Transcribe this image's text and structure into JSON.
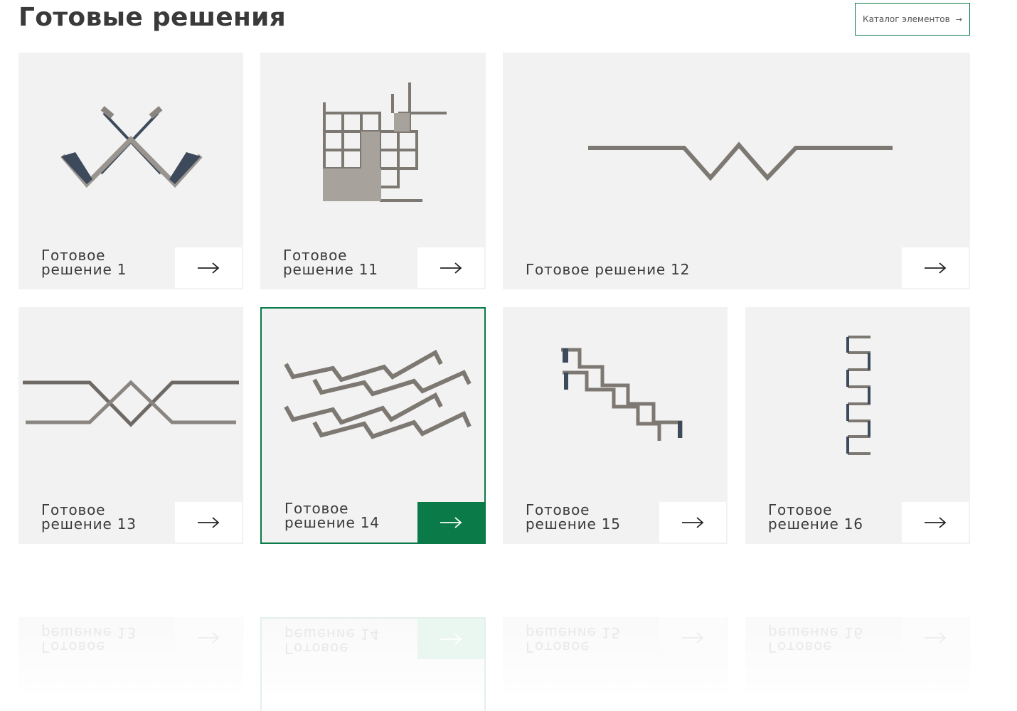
{
  "header": {
    "title": "Готовые решения",
    "catalog_button": "Каталог элементов"
  },
  "cards": [
    {
      "label": "Готовое решение 1"
    },
    {
      "label": "Готовое решение 11"
    },
    {
      "label": "Готовое решение 12"
    },
    {
      "label": "Готовое решение 13"
    },
    {
      "label": "Готовое решение 14",
      "active": true
    },
    {
      "label": "Готовое решение 15"
    },
    {
      "label": "Готовое решение 16"
    }
  ],
  "reflection": [
    {
      "label": "Готовое решение 13"
    },
    {
      "label": "Готовое решение 14"
    },
    {
      "label": "Готовое решение 15"
    },
    {
      "label": "Готовое решение 16"
    }
  ],
  "colors": {
    "accent": "#0a7a48",
    "card_bg": "#f2f2f2",
    "shelf": "#8a8580",
    "shelf_dark": "#3c4a5c"
  }
}
